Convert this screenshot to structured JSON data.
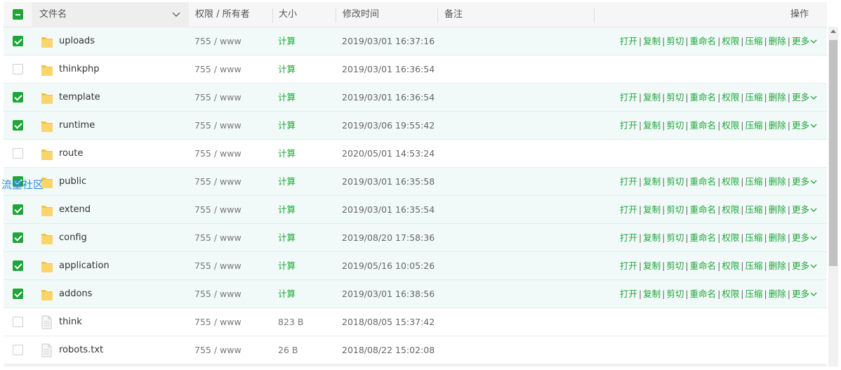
{
  "header": {
    "name": "文件名",
    "perm": "权限 / 所有者",
    "size": "大小",
    "mtime": "修改时间",
    "remark": "备注",
    "ops": "操作"
  },
  "watermark": "流量社区",
  "op_labels": [
    "打开",
    "复制",
    "剪切",
    "重命名",
    "权限",
    "压缩",
    "删除",
    "更多"
  ],
  "rows": [
    {
      "name": "uploads",
      "perm": "755 / www",
      "size": "计算",
      "mtime": "2019/03/01 16:37:16"
    },
    {
      "name": "thinkphp",
      "perm": "755 / www",
      "size": "计算",
      "mtime": "2019/03/01 16:36:54"
    },
    {
      "name": "template",
      "perm": "755 / www",
      "size": "计算",
      "mtime": "2019/03/01 16:36:54"
    },
    {
      "name": "runtime",
      "perm": "755 / www",
      "size": "计算",
      "mtime": "2019/03/06 19:55:42"
    },
    {
      "name": "route",
      "perm": "755 / www",
      "size": "计算",
      "mtime": "2020/05/01 14:53:24"
    },
    {
      "name": "public",
      "perm": "755 / www",
      "size": "计算",
      "mtime": "2019/03/01 16:35:58"
    },
    {
      "name": "extend",
      "perm": "755 / www",
      "size": "计算",
      "mtime": "2019/03/01 16:35:54"
    },
    {
      "name": "config",
      "perm": "755 / www",
      "size": "计算",
      "mtime": "2019/08/20 17:58:36"
    },
    {
      "name": "application",
      "perm": "755 / www",
      "size": "计算",
      "mtime": "2019/05/16 10:05:26"
    },
    {
      "name": "addons",
      "perm": "755 / www",
      "size": "计算",
      "mtime": "2019/03/01 16:38:56"
    },
    {
      "name": "think",
      "perm": "755 / www",
      "size": "823 B",
      "mtime": "2018/08/05 15:37:42"
    },
    {
      "name": "robots.txt",
      "perm": "755 / www",
      "size": "26 B",
      "mtime": "2018/08/22 15:02:08"
    }
  ]
}
